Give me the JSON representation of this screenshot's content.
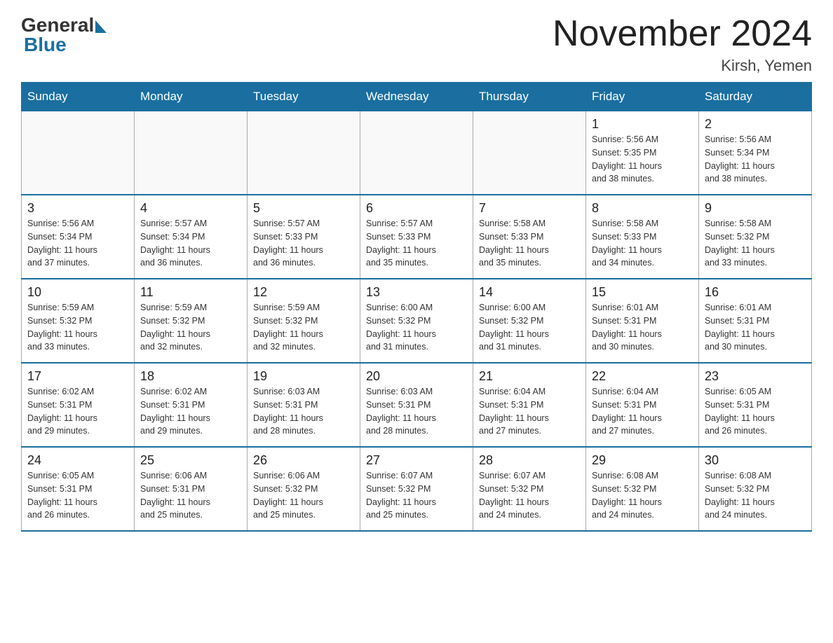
{
  "header": {
    "logo_general": "General",
    "logo_blue": "Blue",
    "month_title": "November 2024",
    "location": "Kirsh, Yemen"
  },
  "weekdays": [
    "Sunday",
    "Monday",
    "Tuesday",
    "Wednesday",
    "Thursday",
    "Friday",
    "Saturday"
  ],
  "weeks": [
    {
      "days": [
        {
          "number": "",
          "info": ""
        },
        {
          "number": "",
          "info": ""
        },
        {
          "number": "",
          "info": ""
        },
        {
          "number": "",
          "info": ""
        },
        {
          "number": "",
          "info": ""
        },
        {
          "number": "1",
          "info": "Sunrise: 5:56 AM\nSunset: 5:35 PM\nDaylight: 11 hours\nand 38 minutes."
        },
        {
          "number": "2",
          "info": "Sunrise: 5:56 AM\nSunset: 5:34 PM\nDaylight: 11 hours\nand 38 minutes."
        }
      ]
    },
    {
      "days": [
        {
          "number": "3",
          "info": "Sunrise: 5:56 AM\nSunset: 5:34 PM\nDaylight: 11 hours\nand 37 minutes."
        },
        {
          "number": "4",
          "info": "Sunrise: 5:57 AM\nSunset: 5:34 PM\nDaylight: 11 hours\nand 36 minutes."
        },
        {
          "number": "5",
          "info": "Sunrise: 5:57 AM\nSunset: 5:33 PM\nDaylight: 11 hours\nand 36 minutes."
        },
        {
          "number": "6",
          "info": "Sunrise: 5:57 AM\nSunset: 5:33 PM\nDaylight: 11 hours\nand 35 minutes."
        },
        {
          "number": "7",
          "info": "Sunrise: 5:58 AM\nSunset: 5:33 PM\nDaylight: 11 hours\nand 35 minutes."
        },
        {
          "number": "8",
          "info": "Sunrise: 5:58 AM\nSunset: 5:33 PM\nDaylight: 11 hours\nand 34 minutes."
        },
        {
          "number": "9",
          "info": "Sunrise: 5:58 AM\nSunset: 5:32 PM\nDaylight: 11 hours\nand 33 minutes."
        }
      ]
    },
    {
      "days": [
        {
          "number": "10",
          "info": "Sunrise: 5:59 AM\nSunset: 5:32 PM\nDaylight: 11 hours\nand 33 minutes."
        },
        {
          "number": "11",
          "info": "Sunrise: 5:59 AM\nSunset: 5:32 PM\nDaylight: 11 hours\nand 32 minutes."
        },
        {
          "number": "12",
          "info": "Sunrise: 5:59 AM\nSunset: 5:32 PM\nDaylight: 11 hours\nand 32 minutes."
        },
        {
          "number": "13",
          "info": "Sunrise: 6:00 AM\nSunset: 5:32 PM\nDaylight: 11 hours\nand 31 minutes."
        },
        {
          "number": "14",
          "info": "Sunrise: 6:00 AM\nSunset: 5:32 PM\nDaylight: 11 hours\nand 31 minutes."
        },
        {
          "number": "15",
          "info": "Sunrise: 6:01 AM\nSunset: 5:31 PM\nDaylight: 11 hours\nand 30 minutes."
        },
        {
          "number": "16",
          "info": "Sunrise: 6:01 AM\nSunset: 5:31 PM\nDaylight: 11 hours\nand 30 minutes."
        }
      ]
    },
    {
      "days": [
        {
          "number": "17",
          "info": "Sunrise: 6:02 AM\nSunset: 5:31 PM\nDaylight: 11 hours\nand 29 minutes."
        },
        {
          "number": "18",
          "info": "Sunrise: 6:02 AM\nSunset: 5:31 PM\nDaylight: 11 hours\nand 29 minutes."
        },
        {
          "number": "19",
          "info": "Sunrise: 6:03 AM\nSunset: 5:31 PM\nDaylight: 11 hours\nand 28 minutes."
        },
        {
          "number": "20",
          "info": "Sunrise: 6:03 AM\nSunset: 5:31 PM\nDaylight: 11 hours\nand 28 minutes."
        },
        {
          "number": "21",
          "info": "Sunrise: 6:04 AM\nSunset: 5:31 PM\nDaylight: 11 hours\nand 27 minutes."
        },
        {
          "number": "22",
          "info": "Sunrise: 6:04 AM\nSunset: 5:31 PM\nDaylight: 11 hours\nand 27 minutes."
        },
        {
          "number": "23",
          "info": "Sunrise: 6:05 AM\nSunset: 5:31 PM\nDaylight: 11 hours\nand 26 minutes."
        }
      ]
    },
    {
      "days": [
        {
          "number": "24",
          "info": "Sunrise: 6:05 AM\nSunset: 5:31 PM\nDaylight: 11 hours\nand 26 minutes."
        },
        {
          "number": "25",
          "info": "Sunrise: 6:06 AM\nSunset: 5:31 PM\nDaylight: 11 hours\nand 25 minutes."
        },
        {
          "number": "26",
          "info": "Sunrise: 6:06 AM\nSunset: 5:32 PM\nDaylight: 11 hours\nand 25 minutes."
        },
        {
          "number": "27",
          "info": "Sunrise: 6:07 AM\nSunset: 5:32 PM\nDaylight: 11 hours\nand 25 minutes."
        },
        {
          "number": "28",
          "info": "Sunrise: 6:07 AM\nSunset: 5:32 PM\nDaylight: 11 hours\nand 24 minutes."
        },
        {
          "number": "29",
          "info": "Sunrise: 6:08 AM\nSunset: 5:32 PM\nDaylight: 11 hours\nand 24 minutes."
        },
        {
          "number": "30",
          "info": "Sunrise: 6:08 AM\nSunset: 5:32 PM\nDaylight: 11 hours\nand 24 minutes."
        }
      ]
    }
  ]
}
